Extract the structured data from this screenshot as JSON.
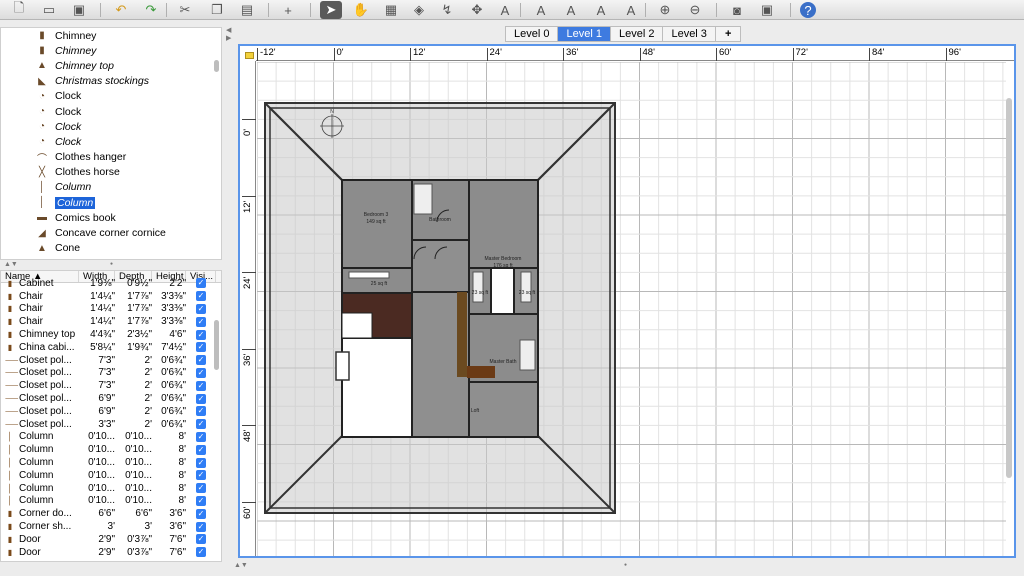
{
  "toolbar": {
    "icons": [
      "new-file-icon",
      "open-folder-icon",
      "save-icon",
      "undo-icon",
      "redo-icon",
      "cut-icon",
      "copy-icon",
      "paste-icon",
      "add-furniture-icon",
      "select-arrow-icon",
      "pan-hand-icon",
      "create-walls-icon",
      "create-rooms-icon",
      "create-polylines-icon",
      "create-dimensions-icon",
      "add-text-icon",
      "text-style-a1-icon",
      "text-style-a2-icon",
      "text-style-a3-icon",
      "text-style-a4-icon",
      "zoom-in-icon",
      "zoom-out-icon",
      "photo-icon",
      "video-icon",
      "help-icon"
    ]
  },
  "catalog": {
    "items": [
      {
        "label": "Chimney",
        "italic": false,
        "icon": "chimney-icon"
      },
      {
        "label": "Chimney",
        "italic": true,
        "icon": "chimney-icon"
      },
      {
        "label": "Chimney top",
        "italic": true,
        "icon": "chimney-top-icon"
      },
      {
        "label": "Christmas stockings",
        "italic": true,
        "icon": "stockings-icon"
      },
      {
        "label": "Clock",
        "italic": false,
        "icon": "clock-icon"
      },
      {
        "label": "Clock",
        "italic": false,
        "icon": "clock-icon"
      },
      {
        "label": "Clock",
        "italic": true,
        "icon": "clock-icon"
      },
      {
        "label": "Clock",
        "italic": true,
        "icon": "clock-icon"
      },
      {
        "label": "Clothes hanger",
        "italic": false,
        "icon": "hanger-icon"
      },
      {
        "label": "Clothes horse",
        "italic": false,
        "icon": "clothes-horse-icon"
      },
      {
        "label": "Column",
        "italic": true,
        "icon": "column-icon"
      },
      {
        "label": "Column",
        "italic": true,
        "icon": "column-icon",
        "selected": true
      },
      {
        "label": "Comics book",
        "italic": false,
        "icon": "book-icon"
      },
      {
        "label": "Concave corner cornice",
        "italic": false,
        "icon": "cornice-icon"
      },
      {
        "label": "Cone",
        "italic": false,
        "icon": "cone-icon"
      }
    ]
  },
  "furniture": {
    "headers": {
      "name": "Name ▲",
      "width": "Width",
      "depth": "Depth",
      "height": "Height",
      "visible": "Visi..."
    },
    "rows": [
      {
        "name": "Cabinet",
        "w": "1'9⅜\"",
        "d": "0'9½\"",
        "h": "2'2\""
      },
      {
        "name": "Chair",
        "w": "1'4¼\"",
        "d": "1'7⅞\"",
        "h": "3'3⅜\""
      },
      {
        "name": "Chair",
        "w": "1'4¼\"",
        "d": "1'7⅞\"",
        "h": "3'3⅜\""
      },
      {
        "name": "Chair",
        "w": "1'4¼\"",
        "d": "1'7⅞\"",
        "h": "3'3⅜\""
      },
      {
        "name": "Chimney top",
        "w": "4'4¾\"",
        "d": "2'3½\"",
        "h": "4'6\""
      },
      {
        "name": "China cabi...",
        "w": "5'8¼\"",
        "d": "1'9¾\"",
        "h": "7'4½\""
      },
      {
        "name": "Closet pol...",
        "w": "7'3\"",
        "d": "2'",
        "h": "0'6¾\""
      },
      {
        "name": "Closet pol...",
        "w": "7'3\"",
        "d": "2'",
        "h": "0'6¾\""
      },
      {
        "name": "Closet pol...",
        "w": "7'3\"",
        "d": "2'",
        "h": "0'6¾\""
      },
      {
        "name": "Closet pol...",
        "w": "6'9\"",
        "d": "2'",
        "h": "0'6¾\""
      },
      {
        "name": "Closet pol...",
        "w": "6'9\"",
        "d": "2'",
        "h": "0'6¾\""
      },
      {
        "name": "Closet pol...",
        "w": "3'3\"",
        "d": "2'",
        "h": "0'6¾\""
      },
      {
        "name": "Column",
        "w": "0'10...",
        "d": "0'10...",
        "h": "8'"
      },
      {
        "name": "Column",
        "w": "0'10...",
        "d": "0'10...",
        "h": "8'"
      },
      {
        "name": "Column",
        "w": "0'10...",
        "d": "0'10...",
        "h": "8'"
      },
      {
        "name": "Column",
        "w": "0'10...",
        "d": "0'10...",
        "h": "8'"
      },
      {
        "name": "Column",
        "w": "0'10...",
        "d": "0'10...",
        "h": "8'"
      },
      {
        "name": "Column",
        "w": "0'10...",
        "d": "0'10...",
        "h": "8'"
      },
      {
        "name": "Corner do...",
        "w": "6'6\"",
        "d": "6'6\"",
        "h": "3'6\""
      },
      {
        "name": "Corner sh...",
        "w": "3'",
        "d": "3'",
        "h": "3'6\""
      },
      {
        "name": "Door",
        "w": "2'9\"",
        "d": "0'3⅞\"",
        "h": "7'6\""
      },
      {
        "name": "Door",
        "w": "2'9\"",
        "d": "0'3⅞\"",
        "h": "7'6\""
      }
    ]
  },
  "levels": {
    "tabs": [
      "Level 0",
      "Level 1",
      "Level 2",
      "Level 3"
    ],
    "active": "Level 1",
    "add": "+"
  },
  "rulers": {
    "top": [
      "-12'",
      "0'",
      "12'",
      "24'",
      "36'",
      "48'",
      "60'",
      "72'",
      "84'",
      "96'"
    ],
    "left": [
      "0'",
      "12'",
      "24'",
      "36'",
      "48'",
      "60'"
    ]
  },
  "rooms": [
    {
      "name": "Bedroom 3",
      "area": "149 sq ft"
    },
    {
      "name": "Bathroom",
      "area": ""
    },
    {
      "name": "Master Bedroom",
      "area": "176 sq ft"
    },
    {
      "name": "",
      "area": "25 sq ft"
    },
    {
      "name": "",
      "area": "23 sq ft"
    },
    {
      "name": "",
      "area": "23 sq ft"
    },
    {
      "name": "Master Bath",
      "area": ""
    },
    {
      "name": "Loft",
      "area": ""
    }
  ],
  "compass": {
    "label": "N"
  }
}
